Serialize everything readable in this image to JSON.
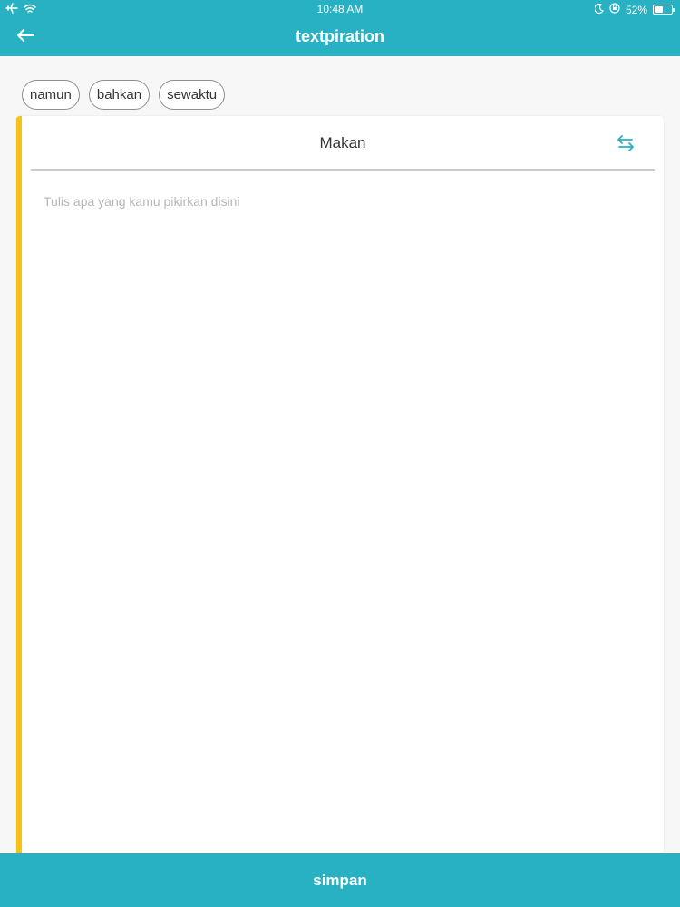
{
  "status_bar": {
    "time": "10:48 AM",
    "battery_text": "52%",
    "battery_level": 0.52,
    "icons": [
      "airplane-icon",
      "wifi-icon",
      "moon-icon",
      "orientation-lock-icon",
      "battery-icon"
    ]
  },
  "navbar": {
    "title": "textpiration",
    "back_icon": "back-arrow-icon"
  },
  "chips": [
    {
      "label": "namun"
    },
    {
      "label": "bahkan"
    },
    {
      "label": "sewaktu"
    }
  ],
  "card": {
    "title": "Makan",
    "swap_icon": "swap-arrows-icon",
    "editor": {
      "value": "",
      "placeholder": "Tulis apa yang kamu pikirkan disini"
    }
  },
  "footer": {
    "save_label": "simpan"
  },
  "colors": {
    "primary": "#27b1c2",
    "accent": "#f5c216",
    "background": "#f7f7f7"
  }
}
